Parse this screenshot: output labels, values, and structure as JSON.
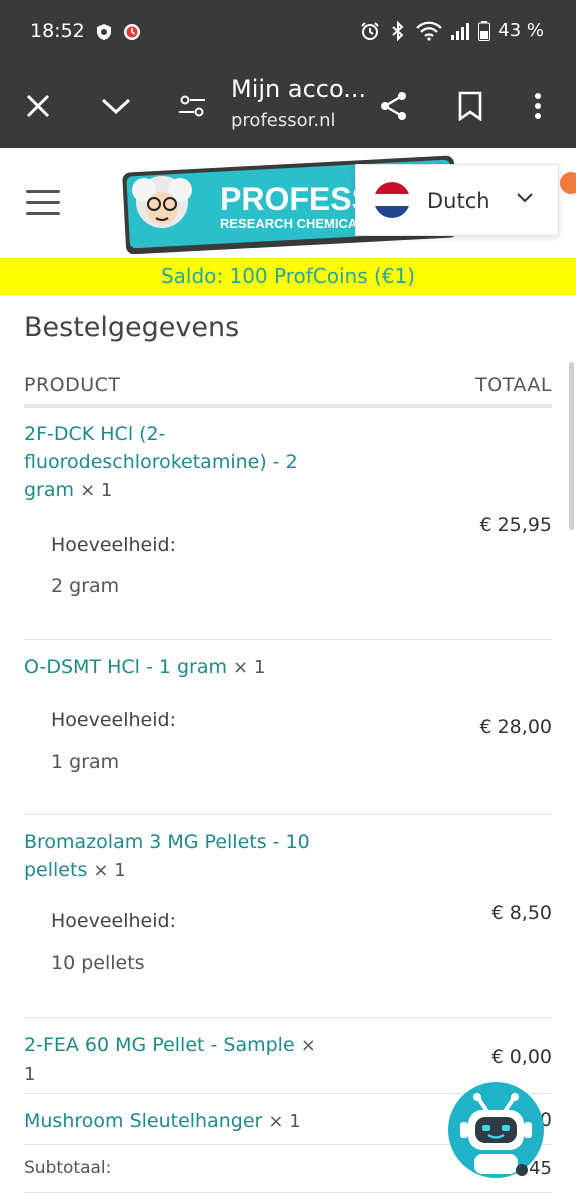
{
  "status_bar": {
    "time": "18:52",
    "battery": "43 %"
  },
  "browser": {
    "title": "Mijn acco...",
    "url": "professor.nl",
    "icons": [
      "close-icon",
      "chevron-down-icon",
      "tune-icon",
      "share-icon",
      "bookmark-icon",
      "more-vert-icon"
    ]
  },
  "header": {
    "logo_text": "PROFESSOR",
    "logo_subtext": "RESEARCH CHEMICALS",
    "language": "Dutch"
  },
  "saldo": "Saldo: 100 ProfCoins (€1)",
  "order": {
    "heading": "Bestelgegevens",
    "col_product": "PRODUCT",
    "col_total": "TOTAAL",
    "meta_label": "Hoeveelheid:",
    "items": [
      {
        "name": "2F-DCK HCl (2-fluorodeschloroketamine) - 2 gram",
        "qty": "× 1",
        "meta_value": "2 gram",
        "price": "€ 25,95"
      },
      {
        "name": "O-DSMT HCl - 1 gram",
        "qty": "× 1",
        "meta_value": "1 gram",
        "price": "€ 28,00"
      },
      {
        "name": "Bromazolam 3 MG Pellets - 10 pellets",
        "qty": "× 1",
        "meta_value": "10 pellets",
        "price": "€ 8,50"
      },
      {
        "name": "2-FEA 60 MG Pellet - Sample",
        "qty": "× 1",
        "price": "€ 0,00"
      },
      {
        "name": "Mushroom Sleutelhanger",
        "qty": "× 1",
        "price": "0"
      }
    ],
    "subtotal_label": "Subtotaal:",
    "subtotal_value": "45"
  },
  "colors": {
    "bar": "#3a3a3a",
    "saldo_bg": "#ffff00",
    "link": "#1f8a8a",
    "logo_teal": "#2bbfc9"
  }
}
